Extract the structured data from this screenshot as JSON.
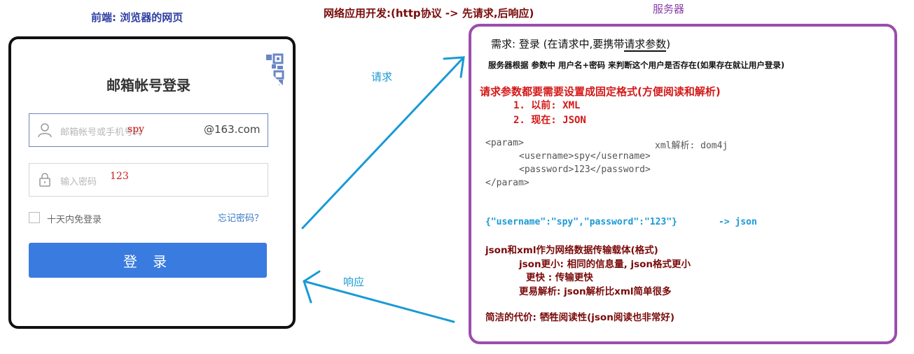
{
  "labels": {
    "frontend": "前端: 浏览器的网页",
    "network_dev": "网络应用开发:(http协议 -> 先请求,后响应)",
    "server": "服务器",
    "request": "请求",
    "response": "响应"
  },
  "login": {
    "title": "邮箱帐号登录",
    "username_placeholder": "邮箱帐号或手机号码",
    "username_value": "spy",
    "domain_suffix": "@163.com",
    "password_placeholder": "输入密码",
    "password_value": "123",
    "remember_label": "十天内免登录",
    "forgot_link": "忘记密码？",
    "submit_label": "登 录"
  },
  "server_box": {
    "requirement_prefix": "需求: 登录 (在请求中,要携带",
    "requirement_highlight": "请求参数",
    "requirement_suffix": ")",
    "check_text": "服务器根据 参数中 用户名+密码 来判断这个用户是否存在(如果存在就让用户登录)",
    "format_heading": "请求参数都要需要设置成固定格式(方便阅读和解析)",
    "option_1": "1. 以前: XML",
    "option_2": "2. 现在: JSON",
    "xml_lines": [
      "<param>",
      "<username>spy</username>",
      "<password>123</password>",
      "</param>"
    ],
    "xml_parser": "xml解析: dom4j",
    "json_example": "{\"username\":\"spy\",\"password\":\"123\"}",
    "json_arrow": "->  json",
    "compare_lines": [
      "json和xml作为网络数据传输载体(格式)",
      "json更小: 相同的信息量, json格式更小",
      "更快 : 传输更快",
      "更易解析: json解析比xml简单很多",
      "简洁的代价: 牺牲阅读性(json阅读也非常好)"
    ]
  },
  "colors": {
    "frontend_label": "#2f3fa0",
    "network_label": "#7a0a0a",
    "server_border": "#9b4dad",
    "arrow": "#1a9ad6",
    "login_button": "#3a7be0",
    "red_text": "#d41818"
  },
  "icons": {
    "qr": "qr-code-icon",
    "user": "user-icon",
    "lock": "lock-icon"
  }
}
